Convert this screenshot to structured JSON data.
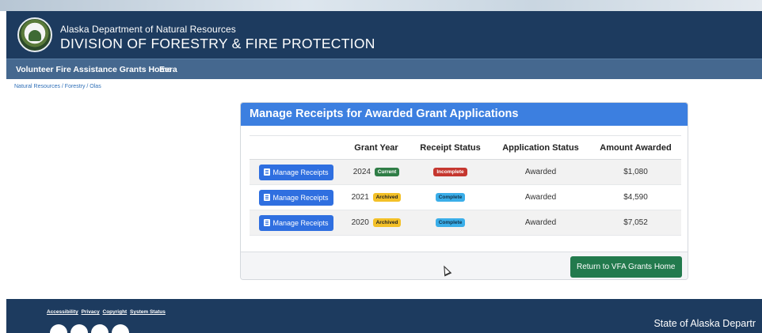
{
  "header": {
    "dept_small": "Alaska Department of Natural Resources",
    "dept_big": "DIVISION OF FORESTRY & FIRE PROTECTION"
  },
  "nav": {
    "home_link": "Volunteer Fire Assistance Grants Home",
    "user_link": "Eera"
  },
  "breadcrumb": "Natural Resources / Forestry / Olas",
  "panel": {
    "title": "Manage Receipts for Awarded Grant Applications",
    "columns": [
      "",
      "Grant Year",
      "Receipt Status",
      "Application Status",
      "Amount Awarded"
    ],
    "rows": [
      {
        "button": "Manage Receipts",
        "year": "2024",
        "year_badge": "Current",
        "receipt_status": "Incomplete",
        "application_status": "Awarded",
        "amount": "$1,080"
      },
      {
        "button": "Manage Receipts",
        "year": "2021",
        "year_badge": "Archived",
        "receipt_status": "Complete",
        "application_status": "Awarded",
        "amount": "$4,590"
      },
      {
        "button": "Manage Receipts",
        "year": "2020",
        "year_badge": "Archived",
        "receipt_status": "Complete",
        "application_status": "Awarded",
        "amount": "$7,052"
      }
    ],
    "return_button": "Return to VFA Grants Home"
  },
  "footer": {
    "links": [
      "Accessibility",
      "Privacy",
      "Copyright",
      "System Status"
    ],
    "state_text": "State of Alaska Departr"
  },
  "icons": {
    "seal": "alaska-dnr-seal-icon",
    "manage": "document-icon",
    "cursor": "mouse-cursor-icon",
    "social": [
      "facebook-icon",
      "instagram-icon",
      "x-icon",
      "youtube-icon"
    ]
  },
  "colors": {
    "header_bg": "#1d3b5f",
    "nav_bg": "#45688f",
    "panel_header": "#3c7fe0",
    "primary_button": "#2f6fe0",
    "success_button": "#227a4d",
    "badge_current": "#2f7d46",
    "badge_archived": "#f3c027",
    "badge_incomplete": "#c5372f",
    "badge_complete": "#3aaee9"
  }
}
